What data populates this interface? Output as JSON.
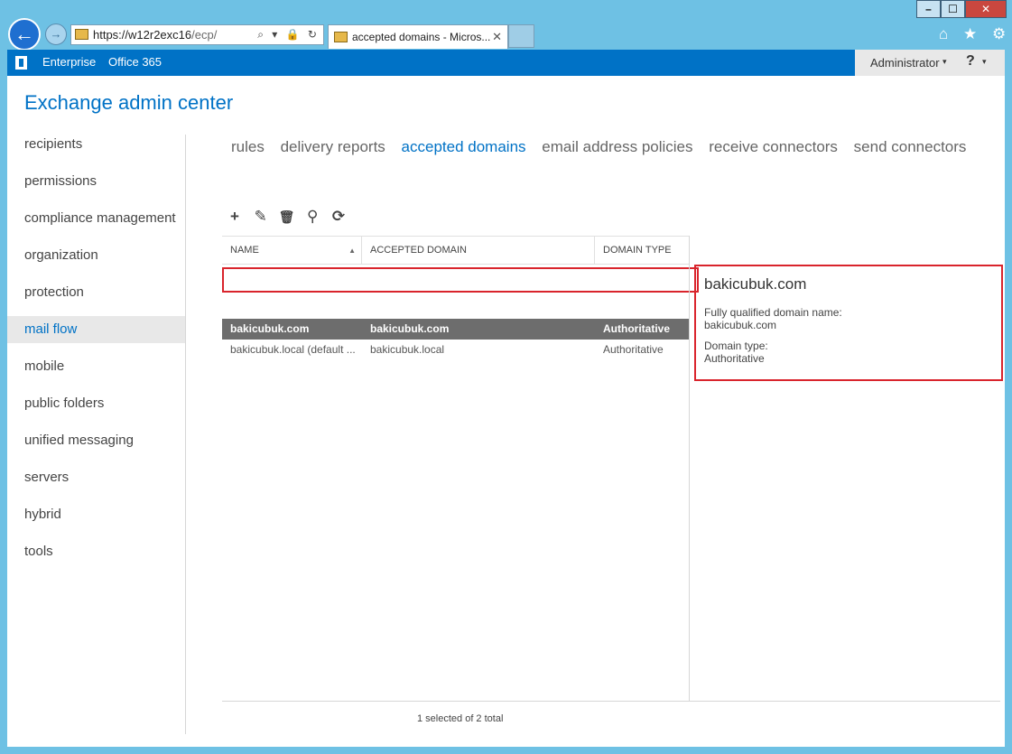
{
  "browser": {
    "url_host": "https://w12r2exc16",
    "url_path": "/ecp/",
    "address_icons": "⌕ ▾ 🔒 ↻",
    "tab_title": "accepted domains - Micros...",
    "tab_close": "✕",
    "back_glyph": "←",
    "forward_glyph": "→",
    "window_controls": {
      "minimize": "–",
      "maximize": "☐",
      "close": "✕"
    },
    "tools": "⌂ ★ ⚙"
  },
  "topbar": {
    "nav": [
      "Enterprise",
      "Office 365"
    ],
    "user": "Administrator",
    "user_caret": "▾",
    "help": "?",
    "help_caret": "▾"
  },
  "app_title": "Exchange admin center",
  "left_nav": {
    "items": [
      "recipients",
      "permissions",
      "compliance management",
      "organization",
      "protection",
      "mail flow",
      "mobile",
      "public folders",
      "unified messaging",
      "servers",
      "hybrid",
      "tools"
    ],
    "active": "mail flow"
  },
  "sub_nav": {
    "items": [
      "rules",
      "delivery reports",
      "accepted domains",
      "email address policies",
      "receive connectors",
      "send connectors"
    ],
    "active": "accepted domains"
  },
  "toolbar": {
    "icons": [
      "add-icon",
      "edit-icon",
      "delete-icon",
      "search-icon",
      "refresh-icon"
    ],
    "glyphs": {
      "add": "+",
      "edit": "✎",
      "delete": "🗑",
      "search": "⚲",
      "refresh": "⟳"
    }
  },
  "grid": {
    "columns": [
      "NAME",
      "ACCEPTED DOMAIN",
      "DOMAIN TYPE"
    ],
    "sort_indicator": "▲",
    "rows": [
      {
        "name": "bakicubuk.com",
        "domain": "bakicubuk.com",
        "type": "Authoritative",
        "selected": true
      },
      {
        "name": "bakicubuk.local (default ...",
        "domain": "bakicubuk.local",
        "type": "Authoritative",
        "selected": false
      }
    ]
  },
  "details": {
    "title": "bakicubuk.com",
    "fqdn_label": "Fully qualified domain name:",
    "fqdn_value": "bakicubuk.com",
    "type_label": "Domain type:",
    "type_value": "Authoritative"
  },
  "status": "1 selected of 2 total",
  "colors": {
    "accent": "#0072c6",
    "selection": "#6d6d6d",
    "highlight": "#d9242c"
  }
}
